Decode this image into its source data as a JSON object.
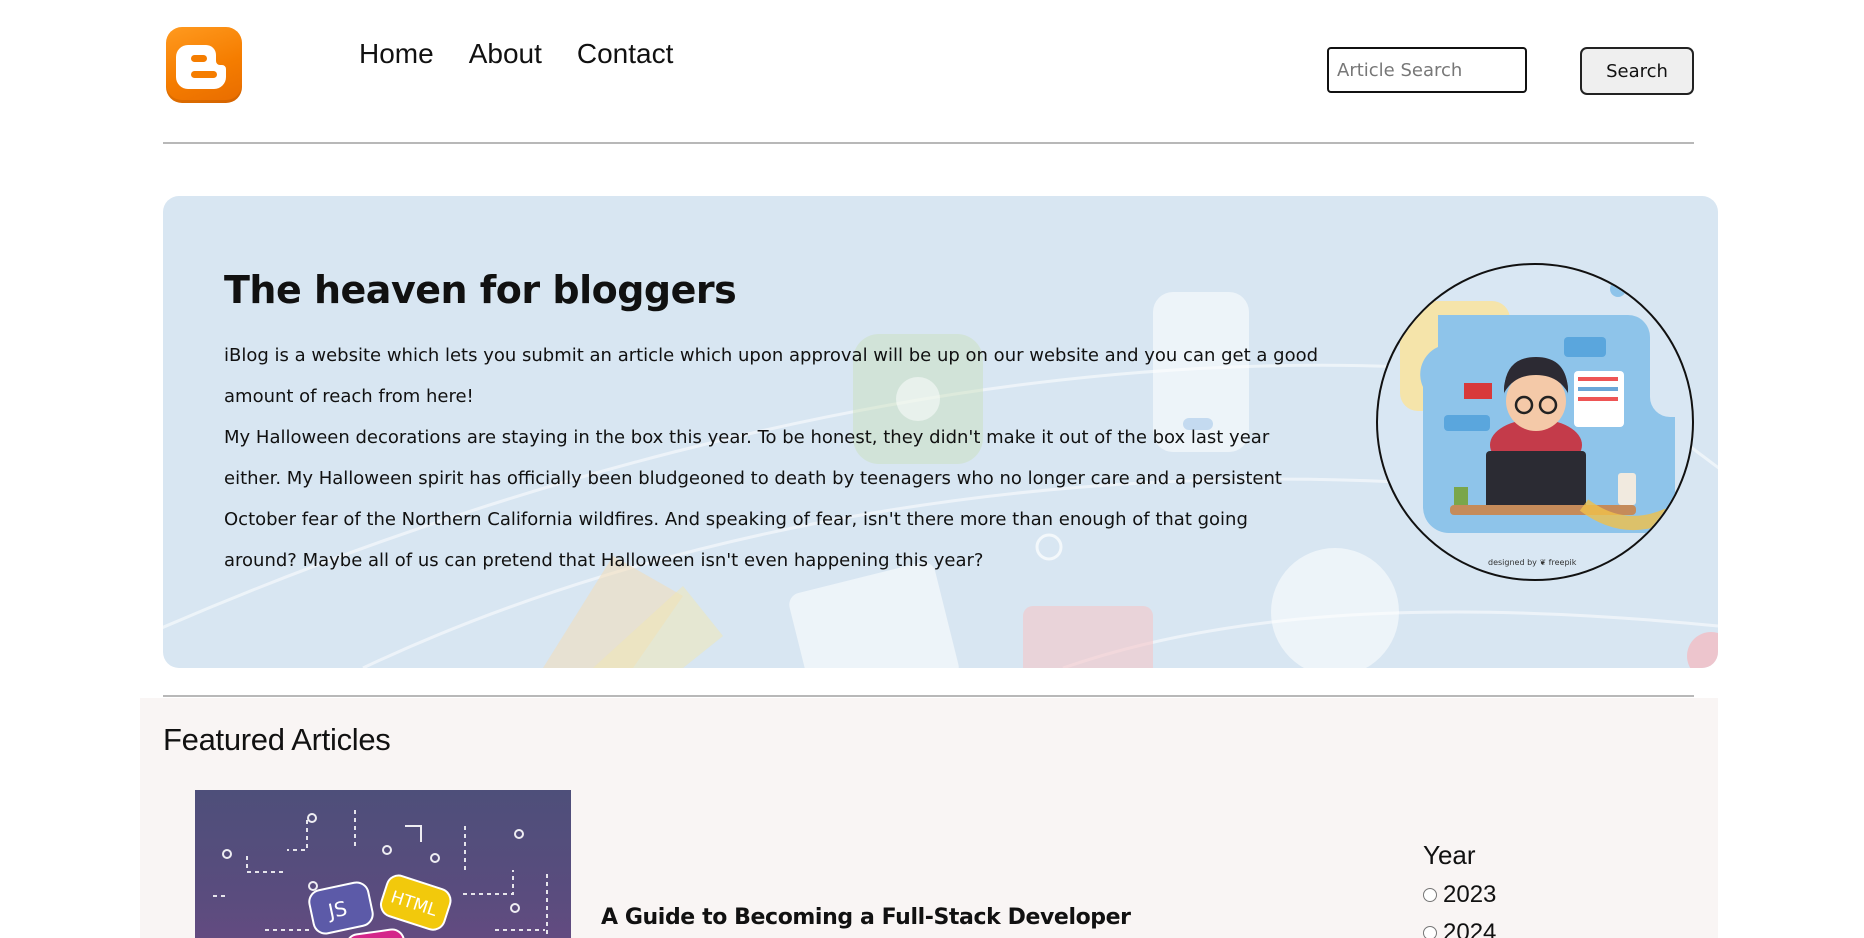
{
  "header": {
    "logo_name": "blogger-logo",
    "nav": [
      {
        "label": "Home"
      },
      {
        "label": "About"
      },
      {
        "label": "Contact"
      }
    ],
    "search": {
      "placeholder": "Article Search",
      "value": "",
      "button_label": "Search"
    }
  },
  "hero": {
    "title": "The heaven for bloggers",
    "paragraphs": [
      "iBlog is a website which lets you submit an article which upon approval will be up on our website and you can get a good amount of reach from here!",
      "My Halloween decorations are staying in the box this year. To be honest, they didn't make it out of the box last year either. My Halloween spirit has officially been bludgeoned to death by teenagers who no longer care and a persistent October fear of the Northern California wildfires. And speaking of fear, isn't there more than enough of that going around? Maybe all of us can pretend that Halloween isn't even happening this year?"
    ],
    "image_credit": "designed by ❦ freepik"
  },
  "featured": {
    "title": "Featured Articles",
    "articles": [
      {
        "title": "A Guide to Becoming a Full-Stack Developer"
      }
    ],
    "filter": {
      "title": "Year",
      "options": [
        {
          "label": "2023",
          "selected": false
        },
        {
          "label": "2024",
          "selected": false
        }
      ]
    }
  },
  "colors": {
    "logo_orange": "#f57d00",
    "hero_background": "#d8e6f2",
    "featured_background": "#f9f5f4",
    "divider": "#b8b8b8"
  }
}
